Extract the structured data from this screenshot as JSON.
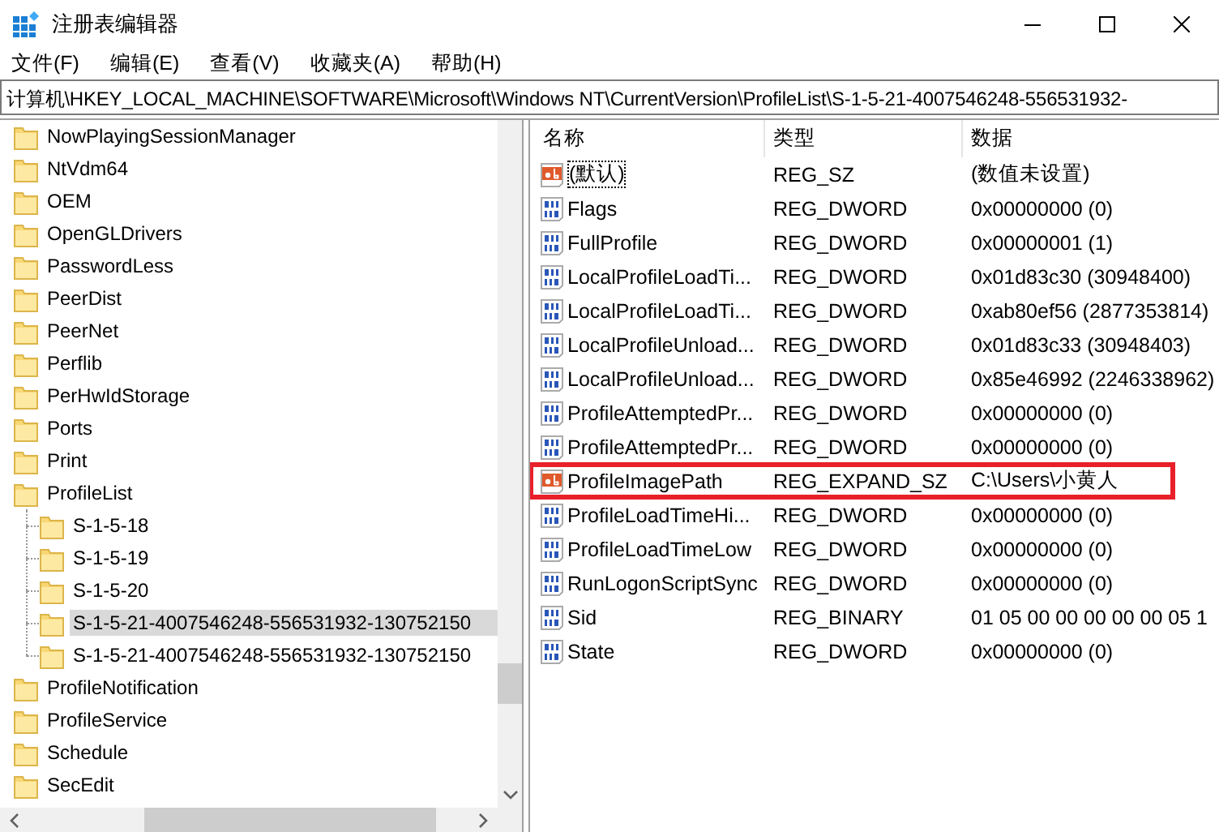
{
  "window": {
    "title": "注册表编辑器"
  },
  "menu": [
    "文件(F)",
    "编辑(E)",
    "查看(V)",
    "收藏夹(A)",
    "帮助(H)"
  ],
  "address": "计算机\\HKEY_LOCAL_MACHINE\\SOFTWARE\\Microsoft\\Windows NT\\CurrentVersion\\ProfileList\\S-1-5-21-4007546248-556531932-",
  "tree": [
    {
      "label": "NowPlayingSessionManager",
      "selected": false
    },
    {
      "label": "NtVdm64",
      "selected": false
    },
    {
      "label": "OEM",
      "selected": false
    },
    {
      "label": "OpenGLDrivers",
      "selected": false
    },
    {
      "label": "PasswordLess",
      "selected": false
    },
    {
      "label": "PeerDist",
      "selected": false
    },
    {
      "label": "PeerNet",
      "selected": false
    },
    {
      "label": "Perflib",
      "selected": false
    },
    {
      "label": "PerHwIdStorage",
      "selected": false
    },
    {
      "label": "Ports",
      "selected": false
    },
    {
      "label": "Print",
      "selected": false
    },
    {
      "label": "ProfileList",
      "selected": false,
      "expanded": true,
      "children": [
        {
          "label": "S-1-5-18",
          "selected": false
        },
        {
          "label": "S-1-5-19",
          "selected": false
        },
        {
          "label": "S-1-5-20",
          "selected": false
        },
        {
          "label": "S-1-5-21-4007546248-556531932-130752150",
          "selected": true
        },
        {
          "label": "S-1-5-21-4007546248-556531932-130752150",
          "selected": false
        }
      ]
    },
    {
      "label": "ProfileNotification",
      "selected": false
    },
    {
      "label": "ProfileService",
      "selected": false
    },
    {
      "label": "Schedule",
      "selected": false
    },
    {
      "label": "SecEdit",
      "selected": false
    }
  ],
  "table": {
    "columns": [
      "名称",
      "类型",
      "数据"
    ],
    "rows": [
      {
        "kind": "string",
        "name": "(默认)",
        "type": "REG_SZ",
        "data": "(数值未设置)",
        "focused": true,
        "highlighted": false
      },
      {
        "kind": "binary",
        "name": "Flags",
        "type": "REG_DWORD",
        "data": "0x00000000 (0)",
        "focused": false,
        "highlighted": false
      },
      {
        "kind": "binary",
        "name": "FullProfile",
        "type": "REG_DWORD",
        "data": "0x00000001 (1)",
        "focused": false,
        "highlighted": false
      },
      {
        "kind": "binary",
        "name": "LocalProfileLoadTi...",
        "type": "REG_DWORD",
        "data": "0x01d83c30 (30948400)",
        "focused": false,
        "highlighted": false
      },
      {
        "kind": "binary",
        "name": "LocalProfileLoadTi...",
        "type": "REG_DWORD",
        "data": "0xab80ef56 (2877353814)",
        "focused": false,
        "highlighted": false
      },
      {
        "kind": "binary",
        "name": "LocalProfileUnload...",
        "type": "REG_DWORD",
        "data": "0x01d83c33 (30948403)",
        "focused": false,
        "highlighted": false
      },
      {
        "kind": "binary",
        "name": "LocalProfileUnload...",
        "type": "REG_DWORD",
        "data": "0x85e46992 (2246338962)",
        "focused": false,
        "highlighted": false
      },
      {
        "kind": "binary",
        "name": "ProfileAttemptedPr...",
        "type": "REG_DWORD",
        "data": "0x00000000 (0)",
        "focused": false,
        "highlighted": false
      },
      {
        "kind": "binary",
        "name": "ProfileAttemptedPr...",
        "type": "REG_DWORD",
        "data": "0x00000000 (0)",
        "focused": false,
        "highlighted": false
      },
      {
        "kind": "string",
        "name": "ProfileImagePath",
        "type": "REG_EXPAND_SZ",
        "data": "C:\\Users\\小黄人",
        "focused": false,
        "highlighted": true
      },
      {
        "kind": "binary",
        "name": "ProfileLoadTimeHi...",
        "type": "REG_DWORD",
        "data": "0x00000000 (0)",
        "focused": false,
        "highlighted": false
      },
      {
        "kind": "binary",
        "name": "ProfileLoadTimeLow",
        "type": "REG_DWORD",
        "data": "0x00000000 (0)",
        "focused": false,
        "highlighted": false
      },
      {
        "kind": "binary",
        "name": "RunLogonScriptSync",
        "type": "REG_DWORD",
        "data": "0x00000000 (0)",
        "focused": false,
        "highlighted": false
      },
      {
        "kind": "binary",
        "name": "Sid",
        "type": "REG_BINARY",
        "data": "01 05 00 00 00 00 00 05 1",
        "focused": false,
        "highlighted": false
      },
      {
        "kind": "binary",
        "name": "State",
        "type": "REG_DWORD",
        "data": "0x00000000 (0)",
        "focused": false,
        "highlighted": false
      }
    ]
  }
}
